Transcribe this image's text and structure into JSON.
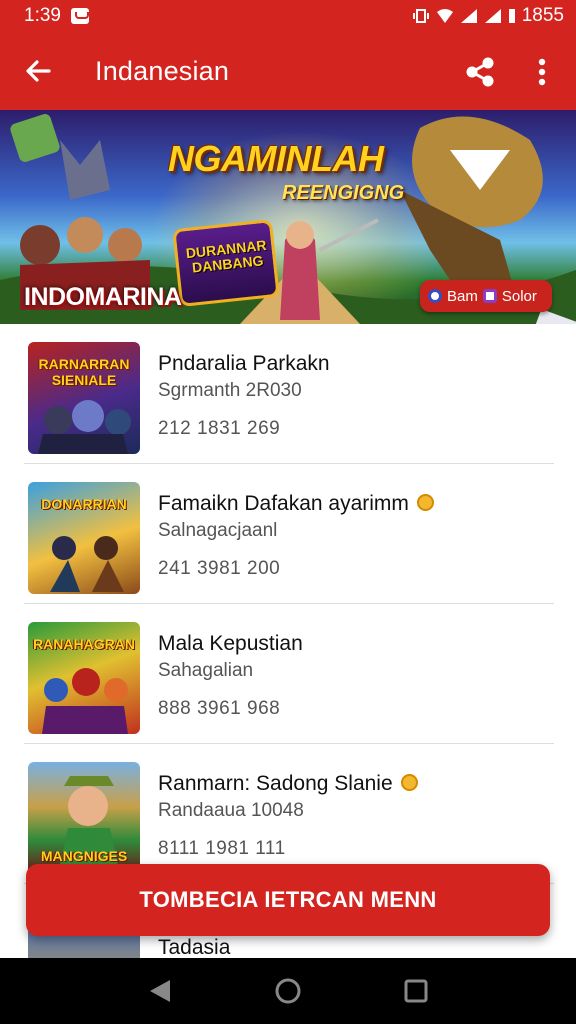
{
  "status_bar": {
    "time": "1:39",
    "battery": "1855"
  },
  "app_bar": {
    "title": "Indanesian"
  },
  "banner": {
    "title": "NGAMINLAH",
    "subtitle": "REENGIGNG",
    "brand": "INDOMARINA",
    "badge_text": "DURANNAR DANBANG",
    "chip_left": "Bam",
    "chip_right": "Solor"
  },
  "items": [
    {
      "title": "Pndaralia Parkakn",
      "subtitle": "Sgrmanth 2R030",
      "stats": "212 1831 269",
      "thumb_text": "RARNARRAN SIENIALE",
      "coin": false
    },
    {
      "title": "Famaikn Dafakan ayarimm",
      "subtitle": "Salnagacjaanl",
      "stats": "241 3981 200",
      "thumb_text": "DONARRIAN",
      "coin": true
    },
    {
      "title": "Mala Kepustian",
      "subtitle": "Sahagalian",
      "stats": "888 3961 968",
      "thumb_text": "RANAHAGRAN",
      "coin": false
    },
    {
      "title": "Ranmarn: Sadong Slanie",
      "subtitle": "Randaaua 10048",
      "stats": "8111 1981 111",
      "thumb_text": "MANGNIGES",
      "coin": true
    },
    {
      "title": "Tadasia",
      "subtitle": "",
      "stats": "",
      "thumb_text": "",
      "coin": false
    }
  ],
  "cta": {
    "label": "TOMBECIA IETRCAN MENN"
  },
  "colors": {
    "primary": "#d32420",
    "text": "#111111",
    "muted": "#555555"
  }
}
